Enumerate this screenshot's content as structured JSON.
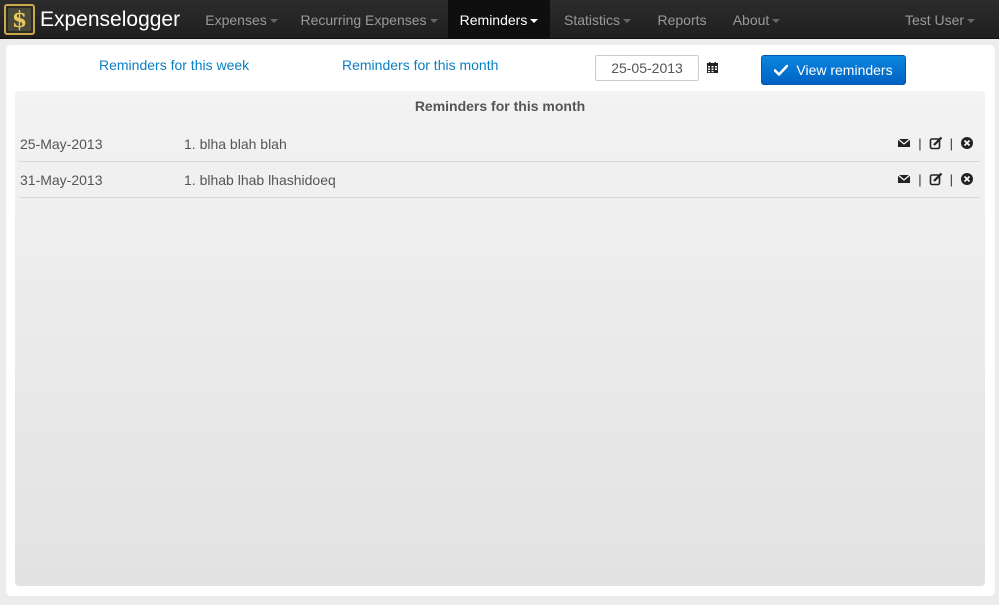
{
  "app": {
    "brand": "Expenselogger",
    "logo_glyph": "$"
  },
  "nav": {
    "items": [
      {
        "label": "Expenses",
        "dropdown": true,
        "active": false
      },
      {
        "label": "Recurring Expenses",
        "dropdown": true,
        "active": false
      },
      {
        "label": "Reminders",
        "dropdown": true,
        "active": true
      },
      {
        "label": "Statistics",
        "dropdown": true,
        "active": false
      },
      {
        "label": "Reports",
        "dropdown": false,
        "active": false
      },
      {
        "label": "About",
        "dropdown": true,
        "active": false
      }
    ],
    "user": {
      "label": "Test User",
      "dropdown": true
    }
  },
  "toolbar": {
    "week_link": "Reminders for this week",
    "month_link": "Reminders for this month",
    "date_value": "25-05-2013",
    "view_button": "View reminders"
  },
  "reminders": {
    "title": "Reminders for this month",
    "rows": [
      {
        "date": "25-May-2013",
        "text": "1. blha blah blah"
      },
      {
        "date": "31-May-2013",
        "text": "1. blhab lhab lhashidoeq"
      }
    ]
  },
  "colors": {
    "accent": "#0a7fc4",
    "button": "#0062c4",
    "navbar": "#222222"
  }
}
